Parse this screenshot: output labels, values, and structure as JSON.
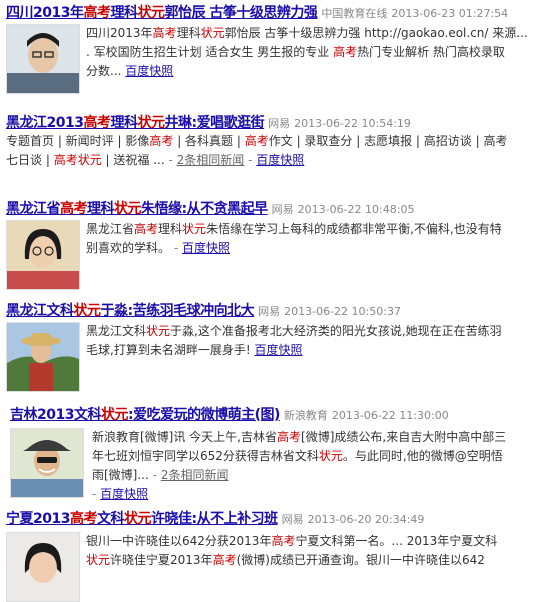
{
  "results": [
    {
      "title": [
        "四川2013年",
        "高考",
        "理科",
        "状元",
        "郭怡辰 古筝十级思辨力强"
      ],
      "source": "中国教育在线",
      "time": "2013-06-23 01:27:54",
      "lines": [
        [
          "四川2013年",
          "高考",
          "理科",
          "状元",
          "郭怡辰 古筝十级思辨力强 http://gaokao.eol.cn/ 来源..."
        ],
        [
          ". 军校国防生招生计划 适合女生 男生报的专业 ",
          "高考",
          "热门专业解析 热门高校录取"
        ],
        [
          "分数..."
        ]
      ],
      "snapshot": "百度快照"
    },
    {
      "title": [
        "黑龙江2013",
        "高考",
        "理科",
        "状元",
        "井琳:爱唱歌逛街"
      ],
      "source": "网易",
      "time": "2013-06-22 10:54:19",
      "lines": [
        [
          "专题首页 | 新闻时评 | 影像",
          "高考",
          " | 各科真题 | ",
          "高考",
          "作文 | 录取查分 | 志愿填报 | 高招访谈 | 高考"
        ],
        [
          "七日谈 | ",
          "高考状元",
          " | 送祝福 ..."
        ]
      ],
      "related": "2条相同新闻",
      "snapshot": "百度快照"
    },
    {
      "title": [
        "黑龙江省",
        "高考",
        "理科",
        "状元",
        "朱悟缘:从不贪黑起早"
      ],
      "source": "网易",
      "time": "2013-06-22 10:48:05",
      "lines": [
        [
          "黑龙江省",
          "高考",
          "理科",
          "状元",
          "朱悟缘在学习上每科的成绩都非常平衡,不偏科,也没有特"
        ],
        [
          "别喜欢的学科。"
        ]
      ],
      "snapshot": "百度快照"
    },
    {
      "title": [
        "黑龙江文科",
        "状元",
        "于淼:苦练羽毛球冲向北大"
      ],
      "source": "网易",
      "time": "2013-06-22 10:50:37",
      "lines": [
        [
          "黑龙江文科",
          "状元",
          "于淼,这个准备报考北大经济类的阳光女孩说,她现在正在苦练羽"
        ],
        [
          "毛球,打算到未名湖畔一展身手!"
        ]
      ],
      "snapshot": "百度快照"
    },
    {
      "title": [
        "吉林2013文科",
        "状元",
        ":爱吃爱玩的微博萌主(图)"
      ],
      "source": "新浪教育",
      "time": "2013-06-22 11:30:00",
      "lines": [
        [
          "新浪教育[微博]讯 今天上午,吉林省",
          "高考",
          "[微博]成绩公布,来自吉大附中高中部三"
        ],
        [
          "年七班刘恒宇同学以652分获得吉林省文科",
          "状元",
          "。与此同时,他的微博@空明悟"
        ],
        [
          "雨[微博]..."
        ]
      ],
      "related": "2条相同新闻",
      "snapshot": "百度快照"
    },
    {
      "title": [
        "宁夏2013",
        "高考",
        "文科",
        "状元",
        "许晓佳:从不上补习班"
      ],
      "source": "网易",
      "time": "2013-06-20 20:34:49",
      "lines": [
        [
          "银川一中许晓佳以642分获2013年",
          "高考",
          "宁夏文科第一名。... 2013年宁夏文科"
        ],
        [
          "状元",
          "许晓佳宁夏2013年",
          "高考",
          "(微博)成绩已开通查询。银川一中许晓佳以642"
        ]
      ]
    }
  ],
  "red_words": [
    "高考",
    "状元",
    "高考状元"
  ],
  "colors": {
    "link": "#1a0dab",
    "highlight": "#cc0000",
    "meta": "#888888"
  }
}
